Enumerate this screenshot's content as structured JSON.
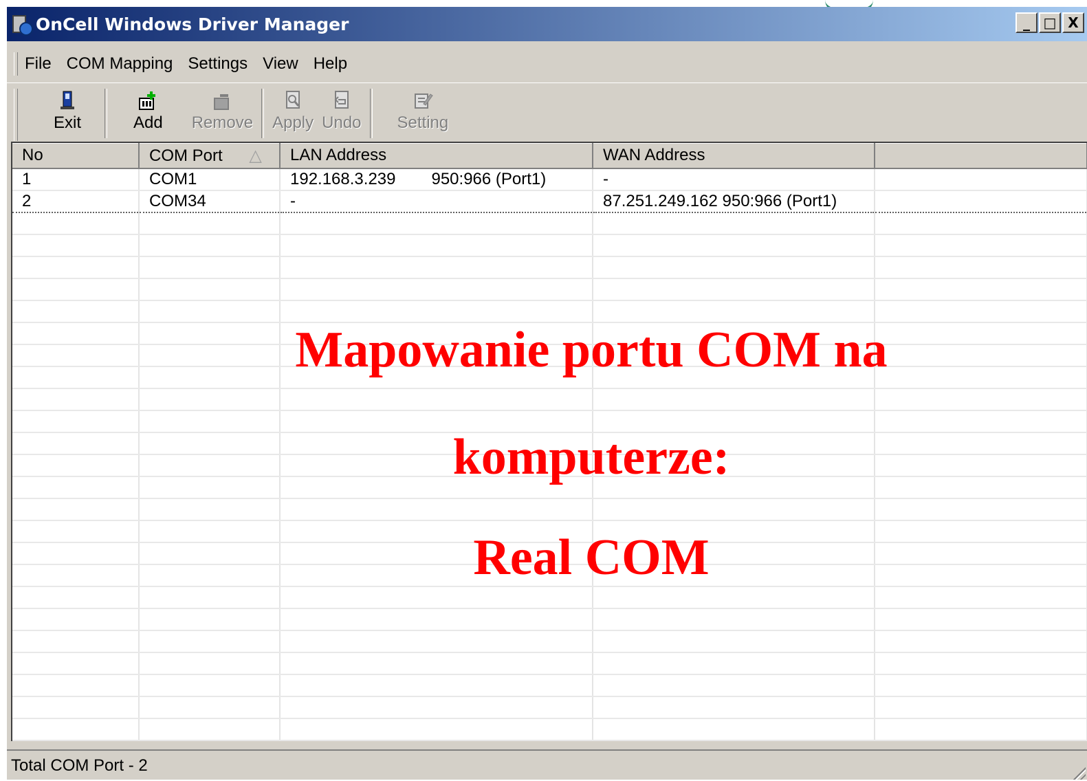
{
  "window": {
    "title": "OnCell Windows Driver Manager",
    "controls": [
      "_",
      "□",
      "X"
    ]
  },
  "menu": [
    "File",
    "COM Mapping",
    "Settings",
    "View",
    "Help"
  ],
  "toolbar": {
    "exit": "Exit",
    "add": "Add",
    "remove": "Remove",
    "apply": "Apply",
    "undo": "Undo",
    "setting": "Setting"
  },
  "table": {
    "columns": [
      "No",
      "COM Port",
      "LAN Address",
      "WAN Address"
    ],
    "sort_indicator": "△",
    "rows": [
      {
        "no": "1",
        "com": "COM1",
        "lan_ip": "192.168.3.239",
        "lan_port": "950:966 (Port1)",
        "wan": "-"
      },
      {
        "no": "2",
        "com": "COM34",
        "lan_ip": "-",
        "lan_port": "",
        "wan": "87.251.249.162  950:966 (Port1)"
      }
    ]
  },
  "status": {
    "text": "Total COM Port - 2"
  },
  "overlay": {
    "line1": "Mapowanie portu COM na",
    "line2": "komputerze:",
    "line3": "Real COM",
    "color": "#ff0000"
  },
  "icons": [
    "app-icon",
    "exit-icon",
    "add-icon",
    "remove-icon",
    "apply-icon",
    "undo-icon",
    "setting-icon"
  ]
}
